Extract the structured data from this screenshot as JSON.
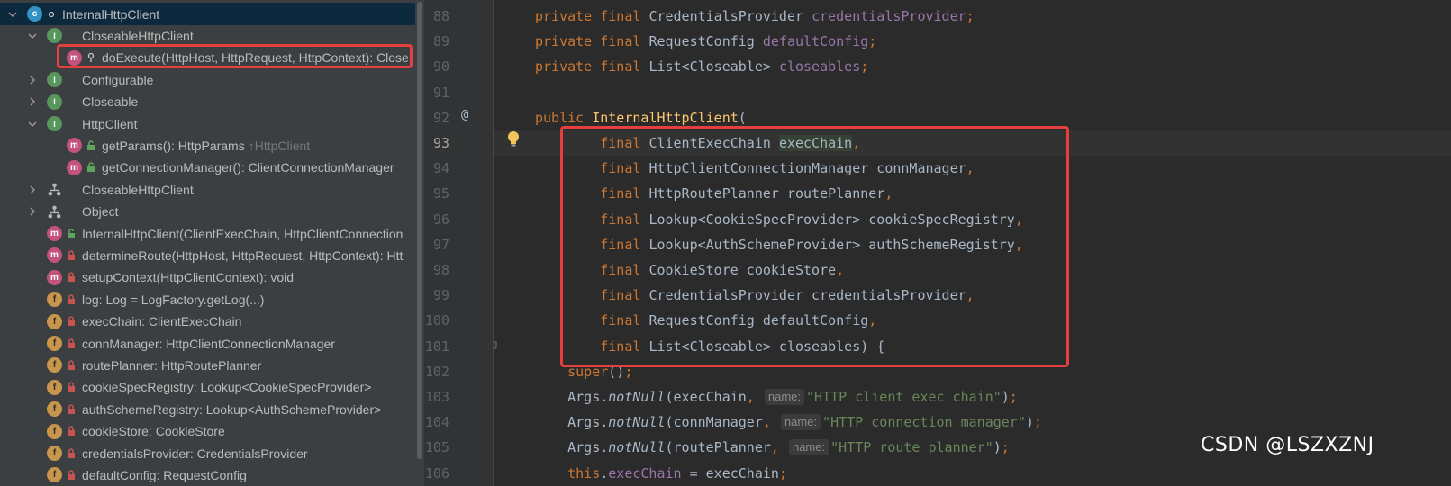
{
  "structure": {
    "rows": [
      {
        "kind": "class",
        "label": "InternalHttpClient",
        "hint": "",
        "expanded": true
      },
      {
        "kind": "interface",
        "label": "CloseableHttpClient",
        "hint": "",
        "expanded": true
      },
      {
        "kind": "method",
        "label": "doExecute(HttpHost, HttpRequest, HttpContext): Close",
        "hint": ""
      },
      {
        "kind": "interface",
        "label": "Configurable",
        "hint": "",
        "expanded": false
      },
      {
        "kind": "interface",
        "label": "Closeable",
        "hint": "",
        "expanded": false
      },
      {
        "kind": "interface",
        "label": "HttpClient",
        "hint": "",
        "expanded": true
      },
      {
        "kind": "method",
        "label": "getParams(): HttpParams",
        "hint": "↑HttpClient"
      },
      {
        "kind": "method",
        "label": "getConnectionManager(): ClientConnectionManager",
        "hint": ""
      },
      {
        "kind": "inherit",
        "label": "CloseableHttpClient",
        "hint": "",
        "expanded": false
      },
      {
        "kind": "inherit",
        "label": "Object",
        "hint": "",
        "expanded": false
      },
      {
        "kind": "method",
        "label": "InternalHttpClient(ClientExecChain, HttpClientConnection",
        "hint": ""
      },
      {
        "kind": "method",
        "label": "determineRoute(HttpHost, HttpRequest, HttpContext): Htt",
        "hint": ""
      },
      {
        "kind": "method",
        "label": "setupContext(HttpClientContext): void",
        "hint": ""
      },
      {
        "kind": "field",
        "label": "log: Log = LogFactory.getLog(...)",
        "hint": ""
      },
      {
        "kind": "field",
        "label": "execChain: ClientExecChain",
        "hint": ""
      },
      {
        "kind": "field",
        "label": "connManager: HttpClientConnectionManager",
        "hint": ""
      },
      {
        "kind": "field",
        "label": "routePlanner: HttpRoutePlanner",
        "hint": ""
      },
      {
        "kind": "field",
        "label": "cookieSpecRegistry: Lookup<CookieSpecProvider>",
        "hint": ""
      },
      {
        "kind": "field",
        "label": "authSchemeRegistry: Lookup<AuthSchemeProvider>",
        "hint": ""
      },
      {
        "kind": "field",
        "label": "cookieStore: CookieStore",
        "hint": ""
      },
      {
        "kind": "field",
        "label": "credentialsProvider: CredentialsProvider",
        "hint": ""
      },
      {
        "kind": "field",
        "label": "defaultConfig: RequestConfig",
        "hint": ""
      }
    ]
  },
  "editor": {
    "line_numbers": [
      "88",
      "89",
      "90",
      "91",
      "92",
      "93",
      "94",
      "95",
      "96",
      "97",
      "98",
      "99",
      "100",
      "101",
      "102",
      "103",
      "104",
      "105",
      "106"
    ],
    "current_line": "93",
    "at_marker": "@",
    "lines": [
      [
        [
          "kw",
          "private final "
        ],
        [
          "p",
          "CredentialsProvider "
        ],
        [
          "fld",
          "credentialsProvider"
        ],
        [
          "kw",
          ";"
        ]
      ],
      [
        [
          "kw",
          "private final "
        ],
        [
          "p",
          "RequestConfig "
        ],
        [
          "fld",
          "defaultConfig"
        ],
        [
          "kw",
          ";"
        ]
      ],
      [
        [
          "kw",
          "private final "
        ],
        [
          "p",
          "List<Closeable> "
        ],
        [
          "fld",
          "closeables"
        ],
        [
          "kw",
          ";"
        ]
      ],
      [],
      [
        [
          "kw",
          "public "
        ],
        [
          "fn",
          "InternalHttpClient"
        ],
        [
          "p",
          "("
        ]
      ],
      [
        [
          "kw",
          "        final "
        ],
        [
          "p",
          "ClientExecChain "
        ],
        [
          "hl",
          "execChain"
        ],
        [
          "kw",
          ","
        ]
      ],
      [
        [
          "kw",
          "        final "
        ],
        [
          "p",
          "HttpClientConnectionManager connManager"
        ],
        [
          "kw",
          ","
        ]
      ],
      [
        [
          "kw",
          "        final "
        ],
        [
          "p",
          "HttpRoutePlanner routePlanner"
        ],
        [
          "kw",
          ","
        ]
      ],
      [
        [
          "kw",
          "        final "
        ],
        [
          "p",
          "Lookup<CookieSpecProvider> cookieSpecRegistry"
        ],
        [
          "kw",
          ","
        ]
      ],
      [
        [
          "kw",
          "        final "
        ],
        [
          "p",
          "Lookup<AuthSchemeProvider> authSchemeRegistry"
        ],
        [
          "kw",
          ","
        ]
      ],
      [
        [
          "kw",
          "        final "
        ],
        [
          "p",
          "CookieStore cookieStore"
        ],
        [
          "kw",
          ","
        ]
      ],
      [
        [
          "kw",
          "        final "
        ],
        [
          "p",
          "CredentialsProvider credentialsProvider"
        ],
        [
          "kw",
          ","
        ]
      ],
      [
        [
          "kw",
          "        final "
        ],
        [
          "p",
          "RequestConfig defaultConfig"
        ],
        [
          "kw",
          ","
        ]
      ],
      [
        [
          "kw",
          "        final "
        ],
        [
          "p",
          "List<Closeable> closeables) {"
        ]
      ],
      [
        [
          "p",
          "    "
        ],
        [
          "kw",
          "super"
        ],
        [
          "p",
          "()"
        ],
        [
          "kw",
          ";"
        ]
      ],
      [
        [
          "p",
          "    Args."
        ],
        [
          "it",
          "notNull"
        ],
        [
          "p",
          "(execChain"
        ],
        [
          "kw",
          ", "
        ],
        [
          "inlay",
          "name:"
        ],
        [
          "str",
          "\"HTTP client exec chain\""
        ],
        [
          "p",
          ")"
        ],
        [
          "kw",
          ";"
        ]
      ],
      [
        [
          "p",
          "    Args."
        ],
        [
          "it",
          "notNull"
        ],
        [
          "p",
          "(connManager"
        ],
        [
          "kw",
          ", "
        ],
        [
          "inlay",
          "name:"
        ],
        [
          "str",
          "\"HTTP connection manager\""
        ],
        [
          "p",
          ")"
        ],
        [
          "kw",
          ";"
        ]
      ],
      [
        [
          "p",
          "    Args."
        ],
        [
          "it",
          "notNull"
        ],
        [
          "p",
          "(routePlanner"
        ],
        [
          "kw",
          ", "
        ],
        [
          "inlay",
          "name:"
        ],
        [
          "str",
          "\"HTTP route planner\""
        ],
        [
          "p",
          ")"
        ],
        [
          "kw",
          ";"
        ]
      ],
      [
        [
          "p",
          "    "
        ],
        [
          "kw",
          "this"
        ],
        [
          "p",
          "."
        ],
        [
          "fld",
          "execChain "
        ],
        [
          "p",
          "= execChain"
        ],
        [
          "kw",
          ";"
        ]
      ]
    ]
  },
  "watermark": "CSDN @LSZXZNJ"
}
